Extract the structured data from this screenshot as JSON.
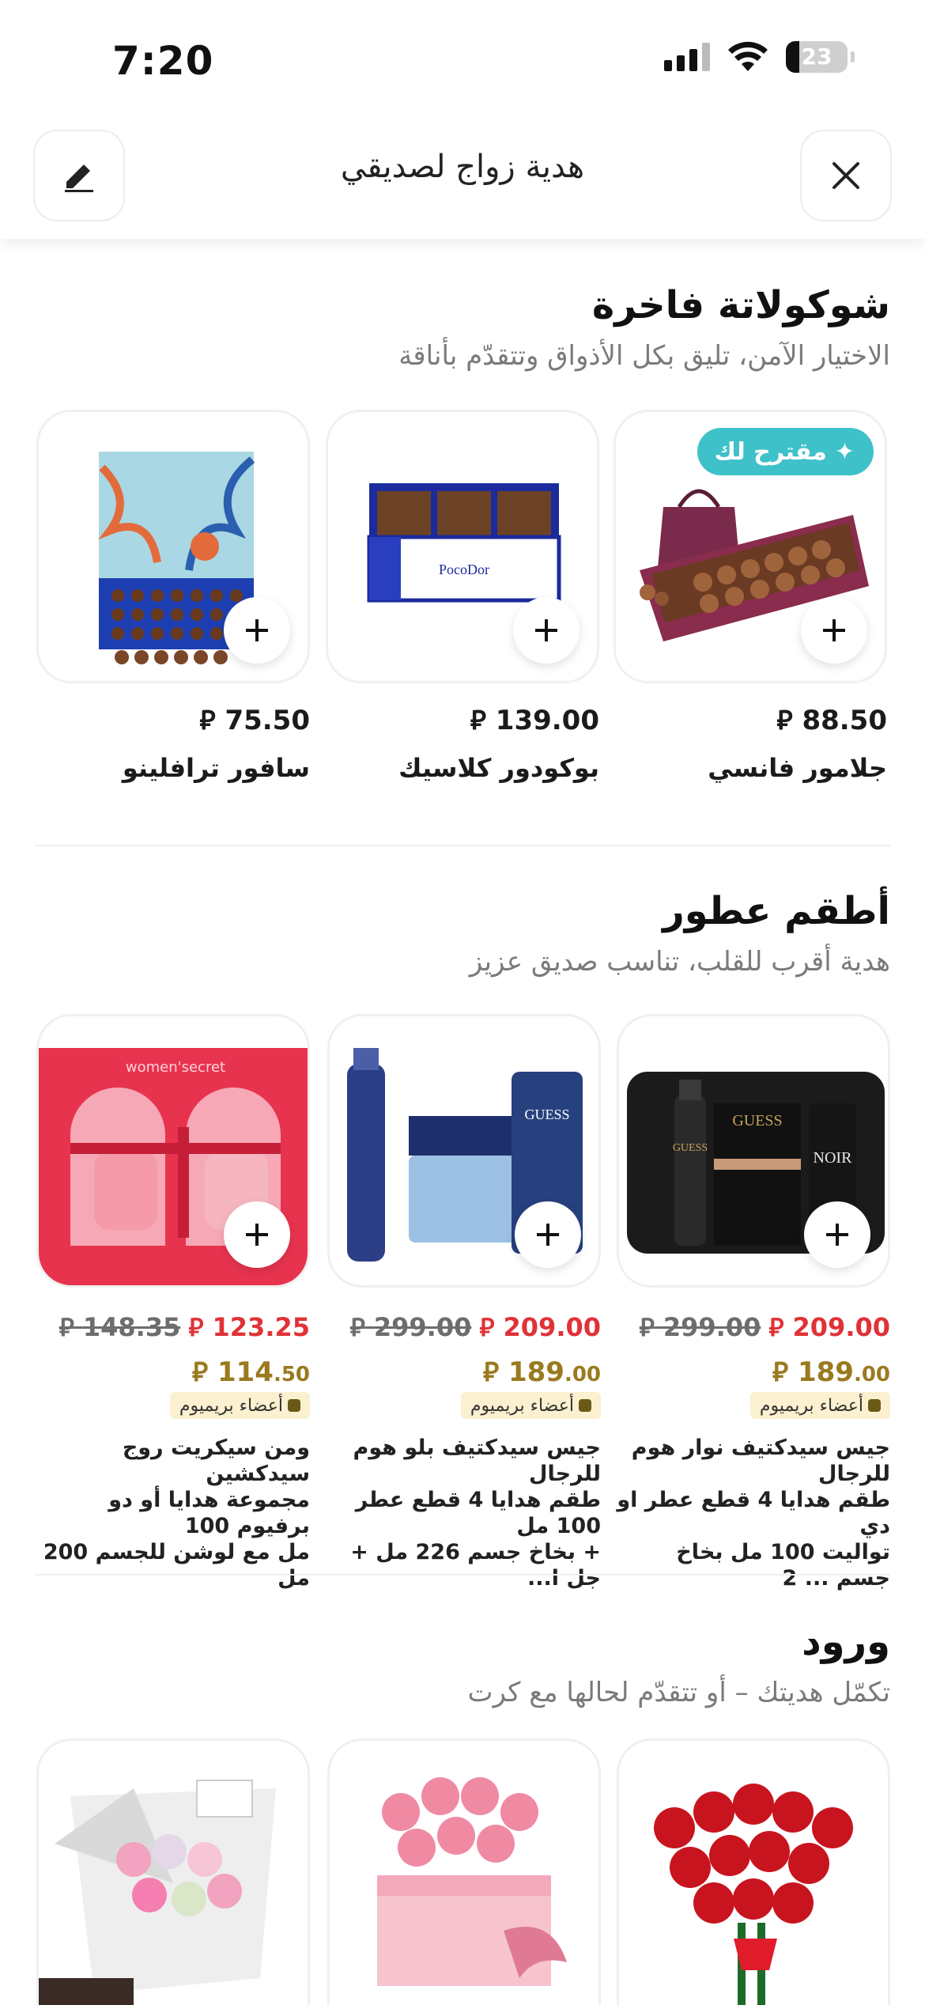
{
  "status_bar": {
    "time": "7:20",
    "battery": "23"
  },
  "header": {
    "title": "هدية زواج لصديقي"
  },
  "sections": [
    {
      "title": "شوكولاتة فاخرة",
      "subtitle": "الاختيار الآمن، تليق بكل الأذواق وتتقدّم بأناقة",
      "badge": "مقترح لك",
      "products": [
        {
          "name": "جلامور فانسي",
          "price": "88.50"
        },
        {
          "name": "بوكودور كلاسيك",
          "price": "139.00"
        },
        {
          "name": "سافور ترافلينو",
          "price": "75.50"
        }
      ]
    },
    {
      "title": "أطقم عطور",
      "subtitle": "هدية أقرب للقلب، تناسب صديق عزيز",
      "premium_label": "أعضاء بريميوم",
      "products": [
        {
          "old_price": "299.00",
          "new_price": "209.00",
          "premium_int": "189",
          "premium_dec": ".00",
          "desc_1": "جيس سيدكتيف نوار هوم للرجال",
          "desc_2": "طقم هدايا 4 قطع عطر  او دي",
          "desc_3": "تواليت 100 مل  بخاخ جسم ... 2"
        },
        {
          "old_price": "299.00",
          "new_price": "209.00",
          "premium_int": "189",
          "premium_dec": ".00",
          "desc_1": "جيس سيدكتيف بلو هوم للرجال",
          "desc_2": "طقم هدايا 4 قطع عطر 100 مل",
          "desc_3": "+ بخاخ جسم 226 مل + جل ا..."
        },
        {
          "old_price": "148.35",
          "new_price": "123.25",
          "premium_int": "114",
          "premium_dec": ".50",
          "desc_1": "ومن سيكريت روج سيدكشين",
          "desc_2": "مجموعة هدايا أو دو برفيوم 100",
          "desc_3": "مل مع لوشن للجسم 200 مل"
        }
      ]
    },
    {
      "title": "ورود",
      "subtitle": "تكمّل هديتك – أو تتقدّم لحالها مع كرت"
    }
  ],
  "currency_symbol": "⃁",
  "colors": {
    "sale_red": "#e03237",
    "premium_gold": "#9a7a1f",
    "badge_teal": "#3fc1c9"
  }
}
